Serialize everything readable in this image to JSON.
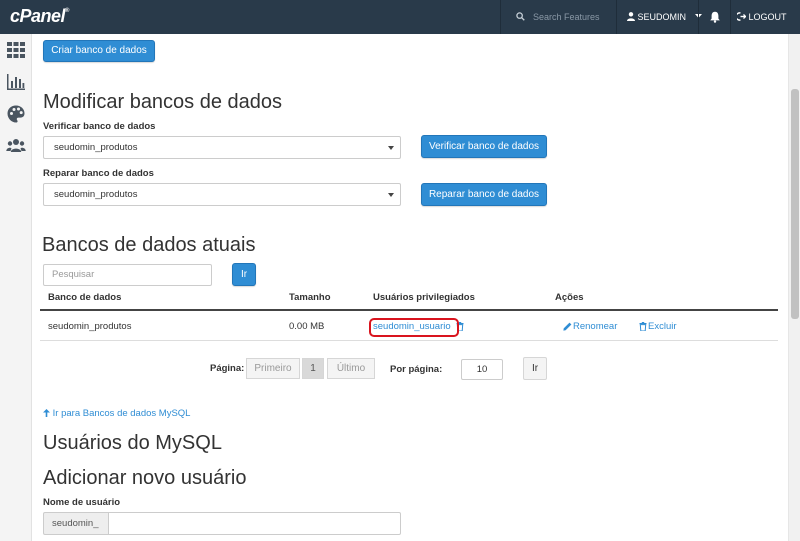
{
  "header": {
    "logo": "cPanel",
    "logo_mark": "®",
    "search_placeholder": "Search Features",
    "user": "SEUDOMIN",
    "logout": "LOGOUT"
  },
  "create": {
    "button": "Criar banco de dados"
  },
  "modify": {
    "title": "Modificar bancos de dados",
    "check_label": "Verificar banco de dados",
    "check_selected": "seudomin_produtos",
    "check_button": "Verificar banco de dados",
    "repair_label": "Reparar banco de dados",
    "repair_selected": "seudomin_produtos",
    "repair_button": "Reparar banco de dados"
  },
  "current": {
    "title": "Bancos de dados atuais",
    "search_placeholder": "Pesquisar",
    "search_button": "Ir",
    "columns": [
      "Banco de dados",
      "Tamanho",
      "Usuários privilegiados",
      "Ações"
    ],
    "rows": [
      {
        "database": "seudomin_produtos",
        "size": "0.00 MB",
        "user": "seudomin_usuario",
        "rename": "Renomear",
        "delete": "Excluir"
      }
    ],
    "pagination": {
      "page_label": "Página:",
      "first": "Primeiro",
      "current": "1",
      "last": "Último",
      "per_page_label": "Por página:",
      "per_page_value": "10",
      "go": "Ir"
    },
    "back_link": "Ir para Bancos de dados MySQL"
  },
  "mysql_users": {
    "title": "Usuários do MySQL",
    "add_title": "Adicionar novo usuário",
    "username_label": "Nome de usuário",
    "prefix": "seudomin_"
  },
  "colors": {
    "topbar": "#293a4a",
    "accent": "#2f8dd4",
    "highlight": "#d9141e"
  }
}
